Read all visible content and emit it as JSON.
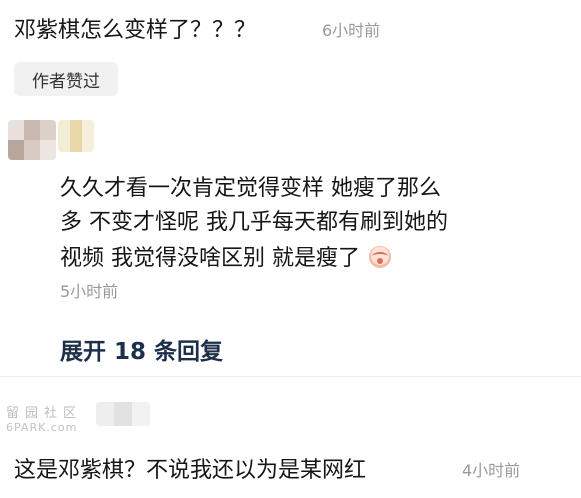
{
  "top_comment": {
    "text": "邓紫棋怎么变样了？？？",
    "time": "6小时前"
  },
  "author_badge": "作者赞过",
  "reply": {
    "lines": [
      "久久才看一次肯定觉得变样 她瘦了那么",
      "多 不变才怪呢 我几乎每天都有刷到她的",
      "视频 我觉得没啥区别 就是瘦了"
    ],
    "emoji": "crying-face-emoji",
    "time": "5小时前"
  },
  "expand_replies": "展开 18 条回复",
  "watermark": {
    "top": "留园社区",
    "bottom": "6PARK.com"
  },
  "bottom_comment": {
    "text": "这是邓紫棋？不说我还以为是某网红",
    "time": "4小时前"
  }
}
